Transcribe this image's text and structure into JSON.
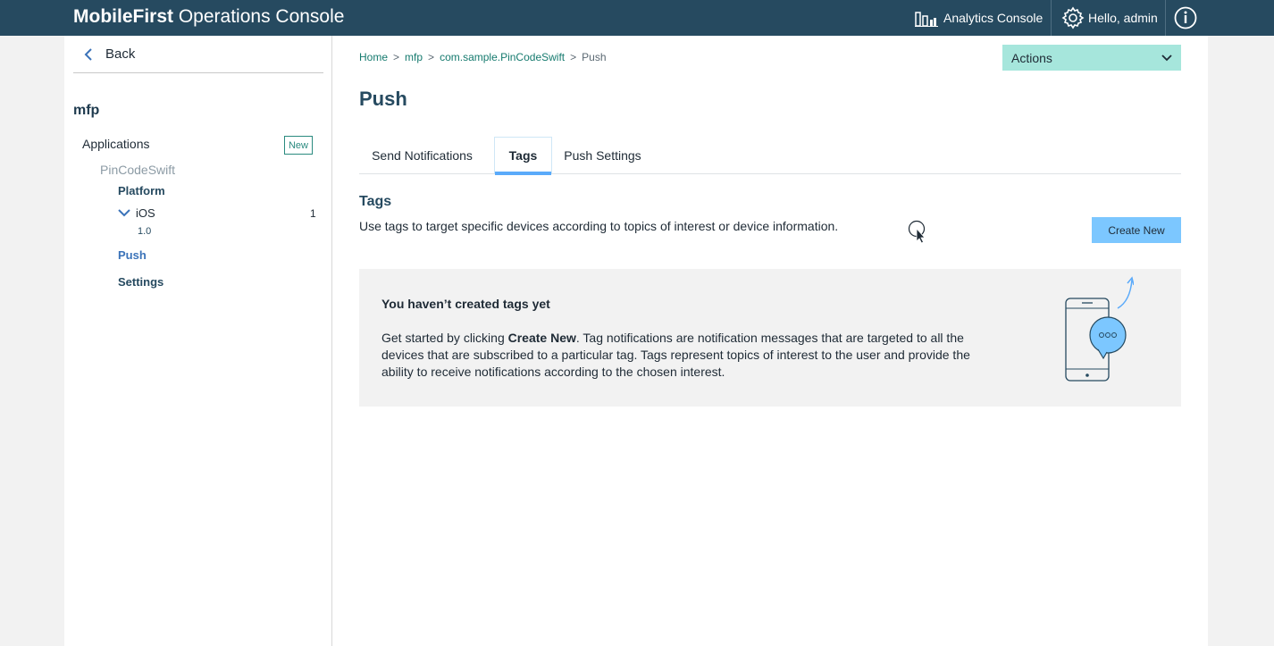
{
  "header": {
    "brand_bold": "MobileFirst",
    "brand_rest": " Operations Console",
    "analytics_label": "Analytics Console",
    "user_label": "Hello, admin",
    "icons": [
      "analytics-chart-icon",
      "gear-icon",
      "info-icon"
    ]
  },
  "sidebar": {
    "back_label": "Back",
    "title": "mfp",
    "applications_label": "Applications",
    "new_label": "New",
    "app_name": "PinCodeSwift",
    "platform_label": "Platform",
    "ios_label": "iOS",
    "ios_count": "1",
    "version_label": "1.0",
    "push_label": "Push",
    "settings_label": "Settings"
  },
  "main": {
    "breadcrumb": {
      "home": "Home",
      "mfp": "mfp",
      "app": "com.sample.PinCodeSwift",
      "current": "Push"
    },
    "actions_label": "Actions",
    "page_title": "Push",
    "tabs": [
      {
        "label": "Send Notifications",
        "active": false
      },
      {
        "label": "Tags",
        "active": true
      },
      {
        "label": "Push Settings",
        "active": false
      }
    ],
    "section_title": "Tags",
    "section_desc": "Use tags to target specific devices according to topics of interest or device information.",
    "create_label": "Create New",
    "empty": {
      "title": "You haven’t created tags yet",
      "text_pre": "Get started by clicking ",
      "text_bold": "Create New",
      "text_post": ". Tag notifications are notification messages that are targeted to all the devices that are subscribed to a particular tag. Tags represent topics of interest to the user and provide the ability to receive notifications according to the chosen interest."
    }
  },
  "colors": {
    "topbar": "#264a60",
    "accent_teal": "#a6e6dc",
    "link": "#157a6e",
    "button_blue": "#7cc7ff",
    "tab_active_underline": "#5aaafa",
    "sidebar_active": "#3b73b9"
  }
}
